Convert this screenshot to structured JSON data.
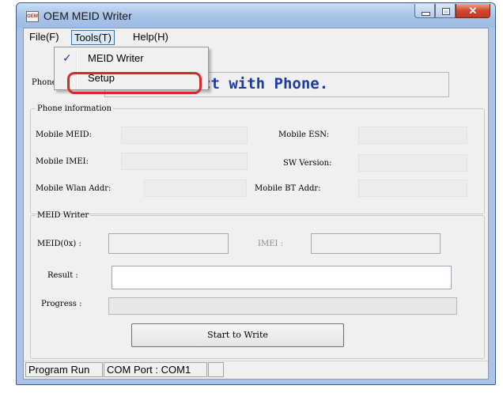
{
  "window": {
    "title": "OEM MEID Writer",
    "icon_text": "OEM"
  },
  "menu": {
    "file": "File(F)",
    "tools": "Tools(T)",
    "help": "Help(H)"
  },
  "tools_menu": {
    "items": [
      {
        "label": "MEID Writer",
        "checked": true
      },
      {
        "label": "Setup",
        "checked": false
      }
    ]
  },
  "phone": {
    "label": "Phone",
    "status": "ct with Phone."
  },
  "phone_info": {
    "legend": "Phone information",
    "meid_label": "Mobile MEID:",
    "esn_label": "Mobile ESN:",
    "imei_label": "Mobile IMEI:",
    "sw_label": "SW Version:",
    "wlan_label": "Mobile Wlan Addr:",
    "bt_label": "Mobile BT Addr:"
  },
  "meid_writer": {
    "legend": "MEID Writer",
    "meid_label": "MEID(0x) :",
    "imei_label": "IMEI :",
    "result_label": "Result :",
    "progress_label": "Progress :",
    "progress_value": 0,
    "start_button": "Start to Write"
  },
  "statusbar": {
    "state": "Program Run",
    "com_port": "COM Port : COM1"
  },
  "colors": {
    "status_text": "#1d3aa3",
    "highlight": "#d9292b"
  }
}
